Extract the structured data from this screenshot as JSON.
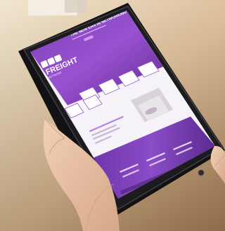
{
  "photo": {
    "colors": {
      "background": "#ffffff",
      "table_light": "#e8d7b8",
      "table_mid": "#caa57a",
      "table_dark": "#8f6a45",
      "tablet_body": "#1c1c1f",
      "tablet_edge": "#4b4b52",
      "screen_purple_top": "#7a3fb8",
      "screen_purple_mid": "#9a52d0",
      "screen_purple_dark": "#5b2a8f",
      "screen_white": "#f5f3f7",
      "accent_line": "#b685e5",
      "hand_skin": "#e9c3a5",
      "hand_shadow": "#c99b7c"
    },
    "screen_text": {
      "hero_heading": "THE NEW ERA IN NETWORKING",
      "brand_line_1": "FREIGHT",
      "brand_line_2": "NETWORK",
      "brand_line_3": "GLOBAL",
      "brand_line_4": "AFFILIATE NETWORK"
    },
    "icons": [
      "logo-mark-icon",
      "play-icon",
      "info-icon",
      "hand-icon"
    ]
  }
}
